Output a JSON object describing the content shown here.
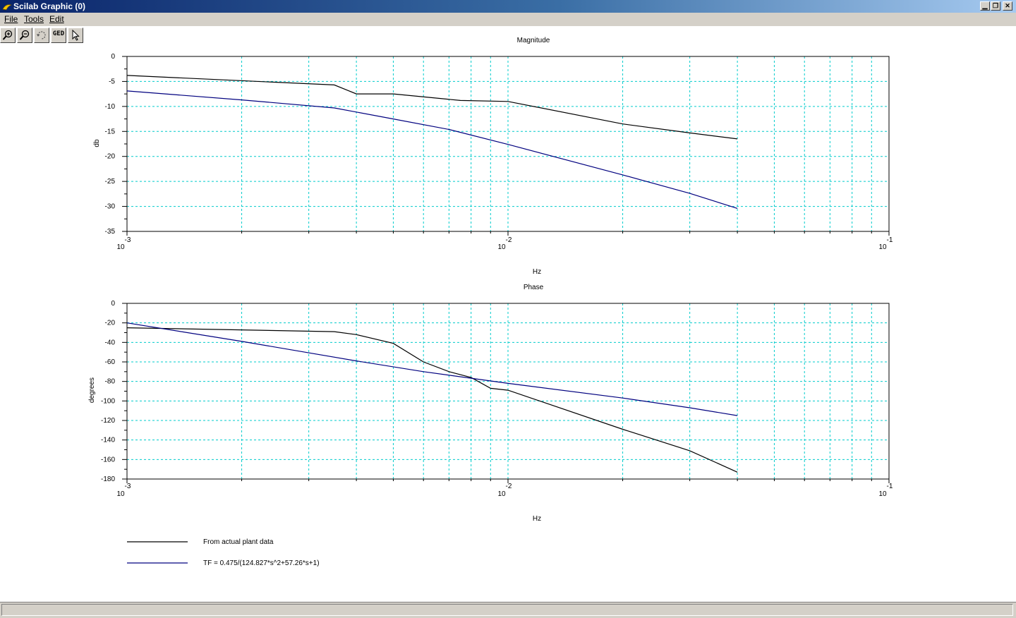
{
  "window": {
    "title": "Scilab Graphic (0)"
  },
  "menu": [
    {
      "label": "File",
      "name": "menu-file"
    },
    {
      "label": "Tools",
      "name": "menu-tools"
    },
    {
      "label": "Edit",
      "name": "menu-edit"
    }
  ],
  "toolbar": [
    {
      "name": "zoom-in-button",
      "icon": "zoom-in-icon"
    },
    {
      "name": "zoom-out-button",
      "icon": "zoom-out-icon"
    },
    {
      "name": "rotate-button",
      "icon": "rotate-icon"
    },
    {
      "name": "ged-button",
      "icon": "ged-icon",
      "label": "GED"
    },
    {
      "name": "select-button",
      "icon": "pointer-icon"
    }
  ],
  "colors": {
    "black_series": "#000000",
    "blue_series": "#00007f",
    "grid": "#00cccc"
  },
  "legend": [
    {
      "label": "From actual plant data",
      "color": "#000000"
    },
    {
      "label": "TF = 0.475/(124.827*s^2+57.26*s+1)",
      "color": "#00007f"
    }
  ],
  "chart_data": [
    {
      "type": "line",
      "title": "Magnitude",
      "xlabel": "Hz",
      "ylabel": "db",
      "xscale": "log",
      "xlim": [
        0.001,
        0.1
      ],
      "ylim": [
        -35,
        0
      ],
      "yticks": [
        0,
        -5,
        -10,
        -15,
        -20,
        -25,
        -30,
        -35
      ],
      "xticks": [
        {
          "base": "10",
          "exp": "-3"
        },
        {
          "base": "10",
          "exp": "-2"
        },
        {
          "base": "10",
          "exp": "-1"
        }
      ],
      "grid": true,
      "series": [
        {
          "name": "From actual plant data",
          "color": "#000000",
          "points": [
            [
              0.001,
              -3.8
            ],
            [
              0.0035,
              -5.7
            ],
            [
              0.004,
              -7.5
            ],
            [
              0.005,
              -7.5
            ],
            [
              0.0075,
              -8.8
            ],
            [
              0.01,
              -9.0
            ],
            [
              0.02,
              -13.5
            ],
            [
              0.03,
              -15.3
            ],
            [
              0.04,
              -16.5
            ]
          ]
        },
        {
          "name": "TF = 0.475/(124.827*s^2+57.26*s+1)",
          "color": "#00007f",
          "points": [
            [
              0.001,
              -6.9
            ],
            [
              0.002,
              -8.7
            ],
            [
              0.0035,
              -10.3
            ],
            [
              0.005,
              -12.5
            ],
            [
              0.007,
              -14.6
            ],
            [
              0.01,
              -17.6
            ],
            [
              0.02,
              -23.7
            ],
            [
              0.03,
              -27.4
            ],
            [
              0.04,
              -30.4
            ]
          ]
        }
      ]
    },
    {
      "type": "line",
      "title": "Phase",
      "xlabel": "Hz",
      "ylabel": "degrees",
      "xscale": "log",
      "xlim": [
        0.001,
        0.1
      ],
      "ylim": [
        -180,
        0
      ],
      "yticks": [
        0,
        -20,
        -40,
        -60,
        -80,
        -100,
        -120,
        -140,
        -160,
        -180
      ],
      "xticks": [
        {
          "base": "10",
          "exp": "-3"
        },
        {
          "base": "10",
          "exp": "-2"
        },
        {
          "base": "10",
          "exp": "-1"
        }
      ],
      "grid": true,
      "series": [
        {
          "name": "From actual plant data",
          "color": "#000000",
          "points": [
            [
              0.001,
              -25
            ],
            [
              0.0035,
              -29
            ],
            [
              0.004,
              -32
            ],
            [
              0.005,
              -41
            ],
            [
              0.006,
              -60
            ],
            [
              0.007,
              -70
            ],
            [
              0.008,
              -76
            ],
            [
              0.009,
              -87
            ],
            [
              0.01,
              -89
            ],
            [
              0.02,
              -129
            ],
            [
              0.03,
              -151
            ],
            [
              0.04,
              -173
            ]
          ]
        },
        {
          "name": "TF = 0.475/(124.827*s^2+57.26*s+1)",
          "color": "#00007f",
          "points": [
            [
              0.001,
              -20
            ],
            [
              0.002,
              -39
            ],
            [
              0.004,
              -59
            ],
            [
              0.006,
              -70
            ],
            [
              0.01,
              -82
            ],
            [
              0.02,
              -97
            ],
            [
              0.03,
              -107
            ],
            [
              0.04,
              -115
            ]
          ]
        }
      ]
    }
  ]
}
